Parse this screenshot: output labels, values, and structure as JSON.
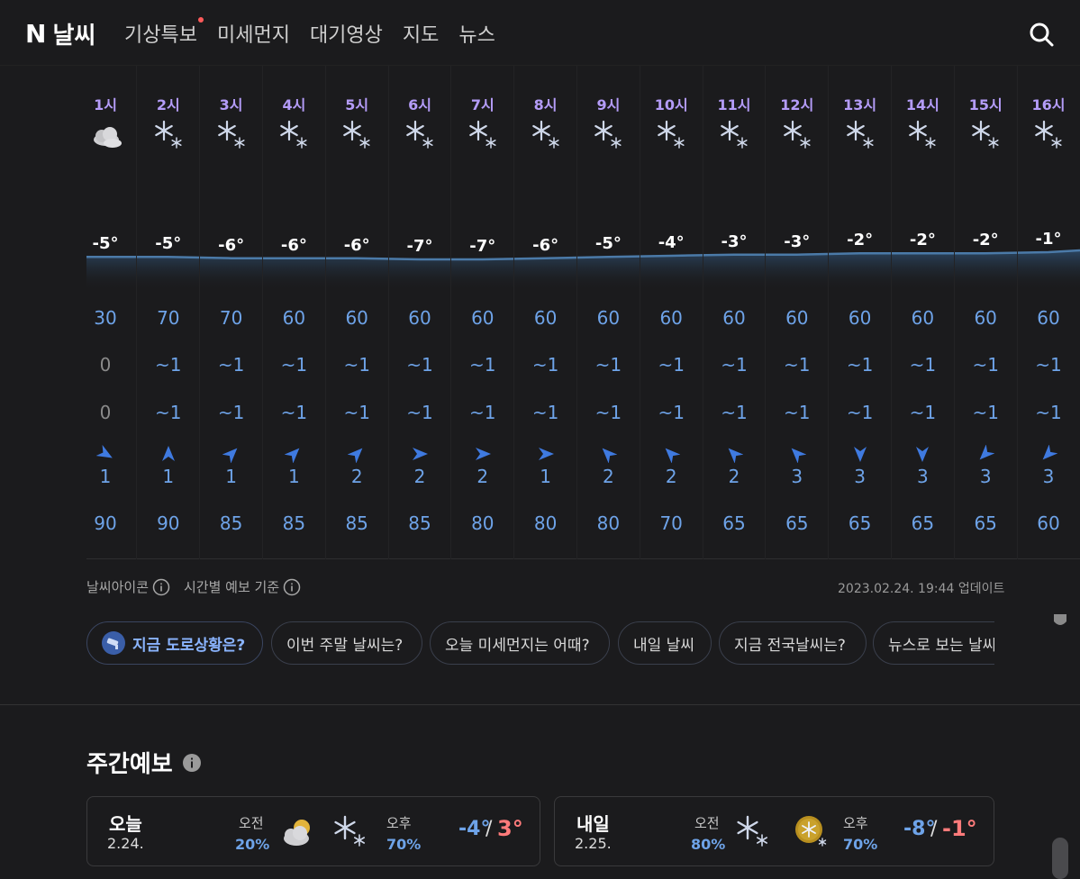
{
  "header": {
    "logo_mark": "N",
    "logo_text": "날씨",
    "nav": [
      "기상특보",
      "미세먼지",
      "대기영상",
      "지도",
      "뉴스"
    ],
    "search_icon": "search-icon"
  },
  "hourly": {
    "hours": [
      "1시",
      "2시",
      "3시",
      "4시",
      "5시",
      "6시",
      "7시",
      "8시",
      "9시",
      "10시",
      "11시",
      "12시",
      "13시",
      "14시",
      "15시",
      "16시"
    ],
    "icons": [
      "cloudy",
      "snow",
      "snow",
      "snow",
      "snow",
      "snow",
      "snow",
      "snow",
      "snow",
      "snow",
      "snow",
      "snow",
      "snow",
      "snow",
      "snow",
      "snow"
    ],
    "temps": [
      "-5°",
      "-5°",
      "-6°",
      "-6°",
      "-6°",
      "-7°",
      "-7°",
      "-6°",
      "-5°",
      "-4°",
      "-3°",
      "-3°",
      "-2°",
      "-2°",
      "-2°",
      "-1°"
    ],
    "temp_values": [
      -5,
      -5,
      -6,
      -6,
      -6,
      -7,
      -7,
      -6,
      -5,
      -4,
      -3,
      -3,
      -2,
      -2,
      -2,
      -1
    ],
    "precip_prob": [
      "30",
      "70",
      "70",
      "60",
      "60",
      "60",
      "60",
      "60",
      "60",
      "60",
      "60",
      "60",
      "60",
      "60",
      "60",
      "60"
    ],
    "rain": [
      "0",
      "~1",
      "~1",
      "~1",
      "~1",
      "~1",
      "~1",
      "~1",
      "~1",
      "~1",
      "~1",
      "~1",
      "~1",
      "~1",
      "~1",
      "~1"
    ],
    "snow": [
      "0",
      "~1",
      "~1",
      "~1",
      "~1",
      "~1",
      "~1",
      "~1",
      "~1",
      "~1",
      "~1",
      "~1",
      "~1",
      "~1",
      "~1",
      "~1"
    ],
    "wind_dir_deg": [
      120,
      0,
      45,
      45,
      45,
      90,
      90,
      90,
      315,
      315,
      315,
      315,
      180,
      180,
      225,
      225
    ],
    "wind_speed": [
      "1",
      "1",
      "1",
      "1",
      "2",
      "2",
      "2",
      "1",
      "2",
      "2",
      "2",
      "3",
      "3",
      "3",
      "3",
      "3"
    ],
    "humidity": [
      "90",
      "90",
      "85",
      "85",
      "85",
      "85",
      "80",
      "80",
      "80",
      "70",
      "65",
      "65",
      "65",
      "65",
      "65",
      "60"
    ]
  },
  "meta": {
    "icon_label": "날씨아이콘",
    "basis_label": "시간별 예보 기준",
    "updated": "2023.02.24. 19:44 업데이트"
  },
  "chips": [
    "지금 도로상황은?",
    "이번 주말 날씨는?",
    "오늘 미세먼지는 어때?",
    "내일 날씨",
    "지금 전국날씨는?",
    "뉴스로 보는 날씨"
  ],
  "weekly": {
    "title": "주간예보",
    "days": [
      {
        "name": "오늘",
        "date": "2.24.",
        "am_label": "오전",
        "am_pct": "20%",
        "am_icon": "partly-cloudy",
        "pm_label": "오후",
        "pm_pct": "70%",
        "pm_icon": "snow",
        "low": "-4°",
        "high": "3°",
        "slash": "/"
      },
      {
        "name": "내일",
        "date": "2.25.",
        "am_label": "오전",
        "am_pct": "80%",
        "am_icon": "snow",
        "pm_label": "오후",
        "pm_pct": "70%",
        "pm_icon": "sun-snow",
        "low": "-8°",
        "high": "-1°",
        "slash": "/"
      }
    ]
  },
  "colors": {
    "accent_purple": "#b49cf8",
    "value_blue": "#6ea3e8",
    "high_red": "#ff7b7b",
    "background": "#1b1b1d"
  }
}
